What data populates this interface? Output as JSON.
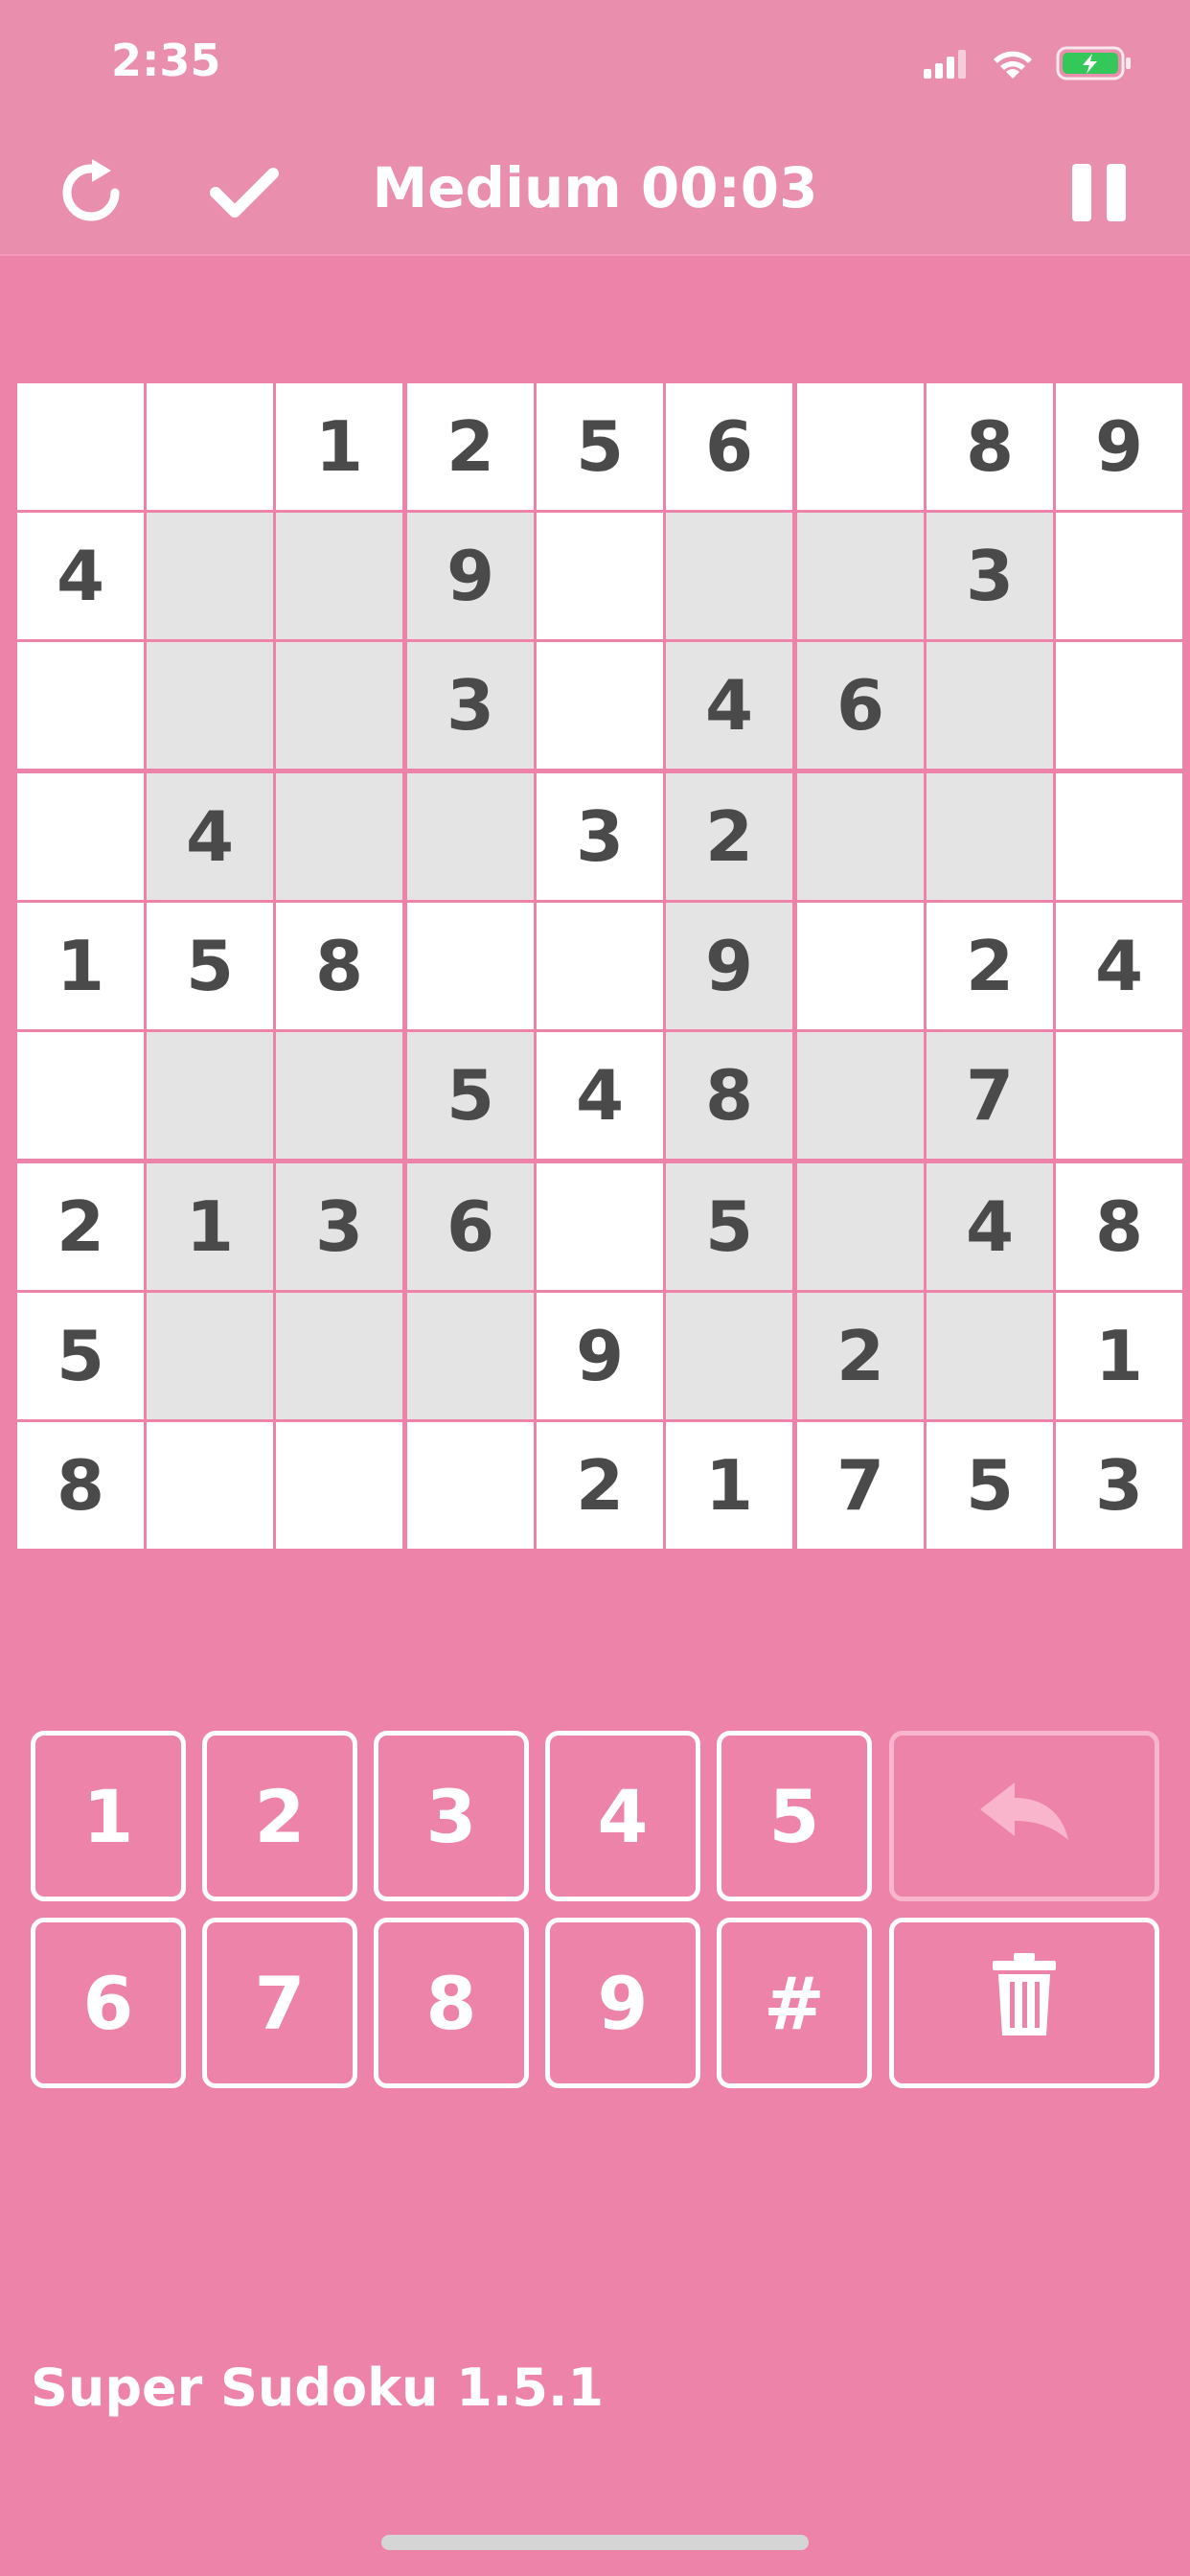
{
  "status_bar": {
    "time": "2:35"
  },
  "header": {
    "title": "Medium 00:03"
  },
  "board": {
    "rows": [
      [
        "",
        "",
        "1",
        "2",
        "5",
        "6",
        "",
        "8",
        "9"
      ],
      [
        "4",
        "",
        "",
        "9",
        "",
        "",
        "",
        "3",
        ""
      ],
      [
        "",
        "",
        "",
        "3",
        "",
        "4",
        "6",
        "",
        ""
      ],
      [
        "",
        "4",
        "",
        "",
        "3",
        "2",
        "",
        "",
        ""
      ],
      [
        "1",
        "5",
        "8",
        "",
        "",
        "9",
        "",
        "2",
        "4"
      ],
      [
        "",
        "",
        "",
        "5",
        "4",
        "8",
        "",
        "7",
        ""
      ],
      [
        "2",
        "1",
        "3",
        "6",
        "",
        "5",
        "",
        "4",
        "8"
      ],
      [
        "5",
        "",
        "",
        "",
        "9",
        "",
        "2",
        "",
        "1"
      ],
      [
        "8",
        "",
        "",
        "",
        "2",
        "1",
        "7",
        "5",
        "3"
      ]
    ],
    "shade": [
      [
        0,
        0,
        0,
        0,
        0,
        0,
        0,
        0,
        0
      ],
      [
        0,
        1,
        1,
        1,
        0,
        1,
        1,
        1,
        0
      ],
      [
        0,
        1,
        1,
        1,
        0,
        1,
        1,
        1,
        0
      ],
      [
        0,
        1,
        1,
        1,
        0,
        1,
        1,
        1,
        0
      ],
      [
        0,
        0,
        0,
        0,
        0,
        1,
        0,
        0,
        0
      ],
      [
        0,
        1,
        1,
        1,
        0,
        1,
        1,
        1,
        0
      ],
      [
        0,
        1,
        1,
        1,
        0,
        1,
        1,
        1,
        0
      ],
      [
        0,
        1,
        1,
        1,
        0,
        1,
        1,
        1,
        0
      ],
      [
        0,
        0,
        0,
        0,
        0,
        0,
        0,
        0,
        0
      ]
    ],
    "colors": {
      "cell": "#ffffff",
      "shaded": "#e4e4e4",
      "digit": "#4a4a4a",
      "background": "#ee83a9"
    }
  },
  "keypad": {
    "row1": [
      "1",
      "2",
      "3",
      "4",
      "5"
    ],
    "row2": [
      "6",
      "7",
      "8",
      "9",
      "#"
    ],
    "undo_icon": "undo-icon",
    "delete_icon": "trash-icon"
  },
  "footer": {
    "version_text": "Super Sudoku 1.5.1"
  },
  "colors": {
    "background": "#ee83a9",
    "header": "#e98eac",
    "accent": "#ffffff"
  }
}
